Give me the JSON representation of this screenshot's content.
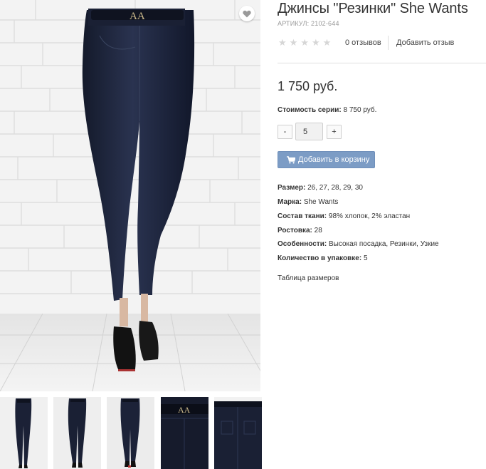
{
  "product": {
    "title": "Джинсы \"Резинки\" She Wants",
    "sku": "АРТИКУЛ: 2102-644",
    "rating": {
      "stars_total": 5,
      "stars_filled": 0,
      "reviews_label": "0 отзывов",
      "add_review_label": "Добавить отзыв"
    },
    "price": "1 750 руб.",
    "series": {
      "label": "Стоимость серии:",
      "value": "8 750 руб."
    },
    "quantity": {
      "minus_label": "-",
      "value": "5",
      "plus_label": "+"
    },
    "add_to_cart_label": "Добавить в корзину",
    "specs": [
      {
        "label": "Размер:",
        "value": "26, 27, 28, 29, 30"
      },
      {
        "label": "Марка:",
        "value": "She Wants"
      },
      {
        "label": "Состав ткани:",
        "value": "98% хлопок, 2% эластан"
      },
      {
        "label": "Ростовка:",
        "value": "28"
      },
      {
        "label": "Особенности:",
        "value": "Высокая посадка, Резинки, Узкие"
      },
      {
        "label": "Количество в упаковке:",
        "value": "5"
      }
    ],
    "size_table_label": "Таблица размеров"
  },
  "icons": {
    "wishlist": "heart-icon",
    "star": "star-icon",
    "cart": "shopping-cart-icon"
  },
  "colors": {
    "accent_button": "#7c9cc5",
    "denim": "#1c2236",
    "star_empty": "#d6d6d6"
  }
}
